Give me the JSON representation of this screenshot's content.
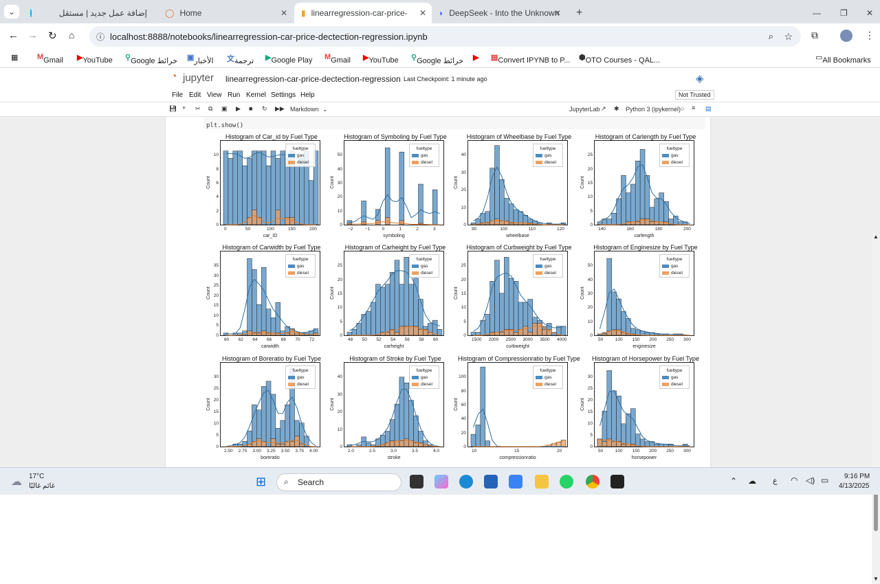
{
  "tabs": [
    {
      "label": "إضافة عمل جديد | مستقل"
    },
    {
      "label": "Home"
    },
    {
      "label": "linearregression-car-price-dectection-regression.ipynb"
    },
    {
      "label": "DeepSeek - Into the Unknown"
    }
  ],
  "url": "localhost:8888/notebooks/linearregression-car-price-dectection-regression.ipynb",
  "bookmarks": [
    "Gmail",
    "YouTube",
    "Google خرائط",
    "الأخبار",
    "ترجمة",
    "Google Play",
    "Gmail",
    "YouTube",
    "Google خرائط",
    "Convert IPYNB to P...",
    "OTO Courses - QAL...",
    "All Bookmarks"
  ],
  "jupyter": {
    "logo": "jupyter",
    "notebook_name": "linearregression-car-price-dectection-regression",
    "checkpoint": "Last Checkpoint: 1 minute ago",
    "trust": "Not Trusted",
    "menu": [
      "File",
      "Edit",
      "View",
      "Run",
      "Kernel",
      "Settings",
      "Help"
    ],
    "cell_type": "Markdown",
    "jupyterlab": "JupyterLab",
    "kernel": "Python 3 (ipykernel)"
  },
  "code_line": "plt.show()",
  "legend": {
    "title": "fueltype",
    "gas": "gas",
    "diesel": "diesel"
  },
  "colors": {
    "gas": "#4c8bbf",
    "diesel": "#f0a060",
    "kde_gas": "#2e6fa3",
    "kde_diesel": "#e07b2a"
  },
  "plots": [
    {
      "title": "Histogram of Car_id by Fuel Type",
      "xlabel": "car_ID",
      "ylabel": "Count",
      "xticks": [
        "0",
        "50",
        "100",
        "150",
        "200"
      ],
      "yticks": [
        "0",
        "2",
        "4",
        "6",
        "8",
        "10"
      ],
      "ymax": 11,
      "gas": [
        10,
        9,
        10,
        10,
        8,
        9,
        10,
        10,
        10,
        8,
        10,
        9,
        10,
        9,
        10,
        8,
        9,
        10,
        6,
        10
      ],
      "diesel": [
        0,
        0,
        0,
        0,
        0,
        1,
        2,
        1,
        0,
        0,
        0,
        2,
        0,
        1,
        1,
        0,
        0,
        0,
        0,
        0
      ]
    },
    {
      "title": "Histogram of Symboling by Fuel Type",
      "xlabel": "symboling",
      "ylabel": "Count",
      "xticks": [
        "−2",
        "−1",
        "0",
        "1",
        "2",
        "3"
      ],
      "yticks": [
        "0",
        "10",
        "20",
        "30",
        "40",
        "50"
      ],
      "ymax": 58,
      "gas": [
        3,
        0,
        0,
        17,
        0,
        0,
        11,
        0,
        55,
        0,
        0,
        52,
        0,
        0,
        0,
        29,
        0,
        0,
        25,
        0
      ],
      "diesel": [
        1,
        0,
        0,
        2,
        0,
        0,
        3,
        0,
        5,
        0,
        0,
        3,
        0,
        0,
        0,
        1,
        0,
        0,
        0,
        0
      ]
    },
    {
      "title": "Histogram of Wheelbase by Fuel Type",
      "xlabel": "wheelbase",
      "ylabel": "Count",
      "xticks": [
        "90",
        "100",
        "110",
        "120"
      ],
      "yticks": [
        "0",
        "10",
        "20",
        "30",
        "40"
      ],
      "ymax": 43,
      "gas": [
        1,
        3,
        6,
        7,
        30,
        42,
        24,
        14,
        11,
        8,
        7,
        5,
        3,
        2,
        1,
        0,
        1,
        0,
        0,
        1
      ],
      "diesel": [
        0,
        0,
        1,
        1,
        2,
        3,
        2,
        2,
        1,
        1,
        1,
        1,
        1,
        0,
        0,
        0,
        0,
        0,
        0,
        0
      ]
    },
    {
      "title": "Histogram of Carlength by Fuel Type",
      "xlabel": "carlength",
      "ylabel": "Count",
      "xticks": [
        "140",
        "160",
        "180",
        "200"
      ],
      "yticks": [
        "0",
        "5",
        "10",
        "15",
        "20",
        "25"
      ],
      "ymax": 28,
      "gas": [
        1,
        2,
        2,
        4,
        9,
        17,
        11,
        14,
        22,
        26,
        17,
        6,
        9,
        11,
        8,
        2,
        3,
        1,
        1,
        0
      ],
      "diesel": [
        0,
        0,
        0,
        0,
        0,
        0,
        1,
        1,
        1,
        2,
        2,
        1,
        1,
        1,
        1,
        0,
        0,
        0,
        0,
        0
      ]
    },
    {
      "title": "Histogram of Carwidth by Fuel Type",
      "xlabel": "carwidth",
      "ylabel": "Count",
      "xticks": [
        "60",
        "62",
        "64",
        "66",
        "68",
        "70",
        "72"
      ],
      "yticks": [
        "0",
        "5",
        "10",
        "15",
        "20",
        "25",
        "30",
        "35"
      ],
      "ymax": 37,
      "gas": [
        1,
        0,
        1,
        1,
        2,
        35,
        30,
        14,
        31,
        12,
        8,
        15,
        2,
        4,
        3,
        1,
        1,
        1,
        2,
        3
      ],
      "diesel": [
        0,
        0,
        0,
        0,
        0,
        2,
        1,
        1,
        2,
        1,
        1,
        1,
        0,
        1,
        3,
        1,
        1,
        0,
        0,
        1
      ]
    },
    {
      "title": "Histogram of Carheight by Fuel Type",
      "xlabel": "carheight",
      "ylabel": "Count",
      "xticks": [
        "48",
        "50",
        "52",
        "54",
        "56",
        "58",
        "60"
      ],
      "yticks": [
        "0",
        "5",
        "10",
        "15",
        "20",
        "25"
      ],
      "ymax": 27,
      "gas": [
        1,
        2,
        4,
        7,
        8,
        11,
        17,
        16,
        17,
        21,
        25,
        17,
        26,
        17,
        19,
        12,
        3,
        4,
        5,
        2
      ],
      "diesel": [
        0,
        0,
        0,
        0,
        0,
        0,
        0,
        1,
        1,
        2,
        1,
        3,
        3,
        3,
        3,
        2,
        2,
        1,
        0,
        0
      ]
    },
    {
      "title": "Histogram of Curbweight by Fuel Type",
      "xlabel": "curbweight",
      "ylabel": "Count",
      "xticks": [
        "1500",
        "2000",
        "2500",
        "3000",
        "3500",
        "4000"
      ],
      "yticks": [
        "0",
        "5",
        "10",
        "15",
        "20",
        "25"
      ],
      "ymax": 27,
      "gas": [
        1,
        1,
        5,
        7,
        18,
        25,
        14,
        26,
        19,
        18,
        11,
        11,
        12,
        6,
        5,
        3,
        4,
        1,
        3,
        3
      ],
      "diesel": [
        0,
        0,
        0,
        0,
        1,
        1,
        1,
        2,
        2,
        1,
        2,
        3,
        1,
        4,
        4,
        2,
        2,
        0,
        0,
        0
      ]
    },
    {
      "title": "Histogram of Enginesize by Fuel Type",
      "xlabel": "enginesize",
      "ylabel": "Count",
      "xticks": [
        "50",
        "100",
        "150",
        "200",
        "250",
        "300"
      ],
      "yticks": [
        "0",
        "10",
        "20",
        "30",
        "40",
        "50"
      ],
      "ymax": 58,
      "gas": [
        1,
        2,
        55,
        31,
        26,
        17,
        12,
        5,
        4,
        3,
        2,
        2,
        1,
        1,
        1,
        0,
        1,
        1,
        0,
        0
      ],
      "diesel": [
        0,
        1,
        3,
        4,
        4,
        2,
        1,
        1,
        0,
        0,
        0,
        0,
        0,
        0,
        0,
        0,
        0,
        0,
        0,
        0
      ]
    },
    {
      "title": "Histogram of Boreratio by Fuel Type",
      "xlabel": "boreratio",
      "ylabel": "Count",
      "xticks": [
        "2.50",
        "2.75",
        "3.00",
        "3.25",
        "3.50",
        "3.75",
        "4.00"
      ],
      "yticks": [
        "0",
        "5",
        "10",
        "15",
        "20",
        "25",
        "30"
      ],
      "ymax": 31,
      "gas": [
        0,
        0,
        1,
        1,
        2,
        6,
        16,
        14,
        23,
        25,
        20,
        7,
        10,
        16,
        30,
        10,
        9,
        4,
        0,
        0
      ],
      "diesel": [
        0,
        0,
        0,
        0,
        0,
        1,
        2,
        3,
        2,
        0,
        3,
        1,
        1,
        2,
        2,
        4,
        1,
        0,
        0,
        0
      ]
    },
    {
      "title": "Histogram of Stroke by Fuel Type",
      "xlabel": "stroke",
      "ylabel": "Count",
      "xticks": [
        "2.0",
        "2.5",
        "3.0",
        "3.5",
        "4.0"
      ],
      "yticks": [
        "0",
        "10",
        "20",
        "30",
        "40"
      ],
      "ymax": 42,
      "gas": [
        1,
        0,
        1,
        5,
        2,
        1,
        4,
        6,
        8,
        14,
        22,
        36,
        33,
        24,
        16,
        8,
        3,
        1,
        0,
        0
      ],
      "diesel": [
        0,
        0,
        0,
        0,
        0,
        0,
        0,
        1,
        2,
        3,
        3,
        3,
        4,
        3,
        2,
        2,
        1,
        0,
        0,
        0
      ]
    },
    {
      "title": "Histogram of Compressionratio by Fuel Type",
      "xlabel": "compressionratio",
      "ylabel": "Count",
      "xticks": [
        "10",
        "15",
        "20"
      ],
      "yticks": [
        "0",
        "20",
        "40",
        "60",
        "80",
        "100"
      ],
      "ymax": 112,
      "gas": [
        17,
        30,
        110,
        8,
        0,
        0,
        0,
        0,
        0,
        0,
        0,
        0,
        0,
        0,
        0,
        0,
        0,
        0,
        0,
        0
      ],
      "diesel": [
        0,
        0,
        0,
        0,
        0,
        0,
        0,
        0,
        0,
        0,
        0,
        0,
        0,
        0,
        0,
        0,
        2,
        4,
        6,
        9
      ]
    },
    {
      "title": "Histogram of Horsepower by Fuel Type",
      "xlabel": "horsepower",
      "ylabel": "Count",
      "xticks": [
        "50",
        "100",
        "150",
        "200",
        "250",
        "300"
      ],
      "yticks": [
        "0",
        "5",
        "10",
        "15",
        "20",
        "25",
        "30"
      ],
      "ymax": 32,
      "gas": [
        3,
        14,
        30,
        22,
        20,
        9,
        13,
        15,
        5,
        3,
        2,
        2,
        1,
        1,
        1,
        1,
        0,
        0,
        1,
        0
      ],
      "diesel": [
        3,
        2,
        3,
        2,
        2,
        1,
        1,
        1,
        0,
        0,
        0,
        0,
        0,
        0,
        0,
        0,
        0,
        0,
        0,
        0
      ]
    }
  ],
  "taskbar": {
    "temp": "17°C",
    "weather": "غائم غالبًا",
    "search": "Search",
    "time": "9:16 PM",
    "date": "4/13/2025",
    "lang": "ع"
  }
}
